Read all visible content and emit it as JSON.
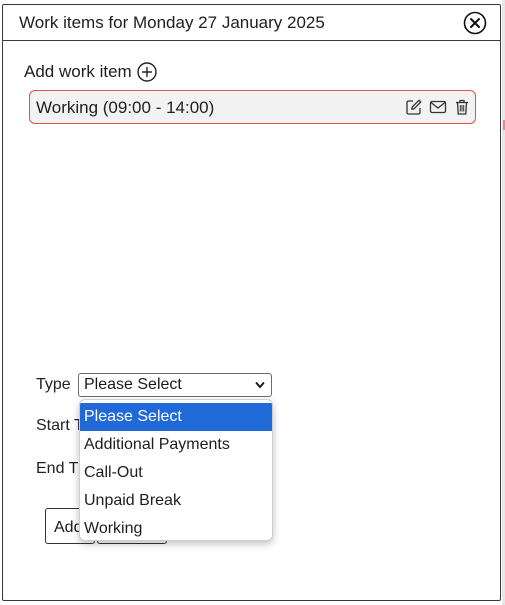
{
  "dialog": {
    "title": "Work items for Monday 27 January 2025"
  },
  "add_work_item": {
    "label": "Add work item"
  },
  "work_items": [
    {
      "label": "Working (09:00 - 14:00)"
    }
  ],
  "form": {
    "type_label": "Type",
    "type_selected": "Please Select",
    "start_label": "Start T",
    "end_label": "End T",
    "add_button_label": "Add",
    "cancel_button_label": ""
  },
  "type_options": [
    {
      "label": "Please Select",
      "selected": true
    },
    {
      "label": "Additional Payments",
      "selected": false
    },
    {
      "label": "Call-Out",
      "selected": false
    },
    {
      "label": "Unpaid Break",
      "selected": false
    },
    {
      "label": "Working",
      "selected": false
    }
  ],
  "colors": {
    "work_item_border": "#e05252",
    "selected_option": "#1f69d8"
  },
  "icons": {
    "close": "close-circle-icon",
    "add": "plus-circle-icon",
    "edit": "edit-icon",
    "email": "envelope-icon",
    "delete": "trash-icon",
    "select_chevron": "chevron-down-icon"
  }
}
